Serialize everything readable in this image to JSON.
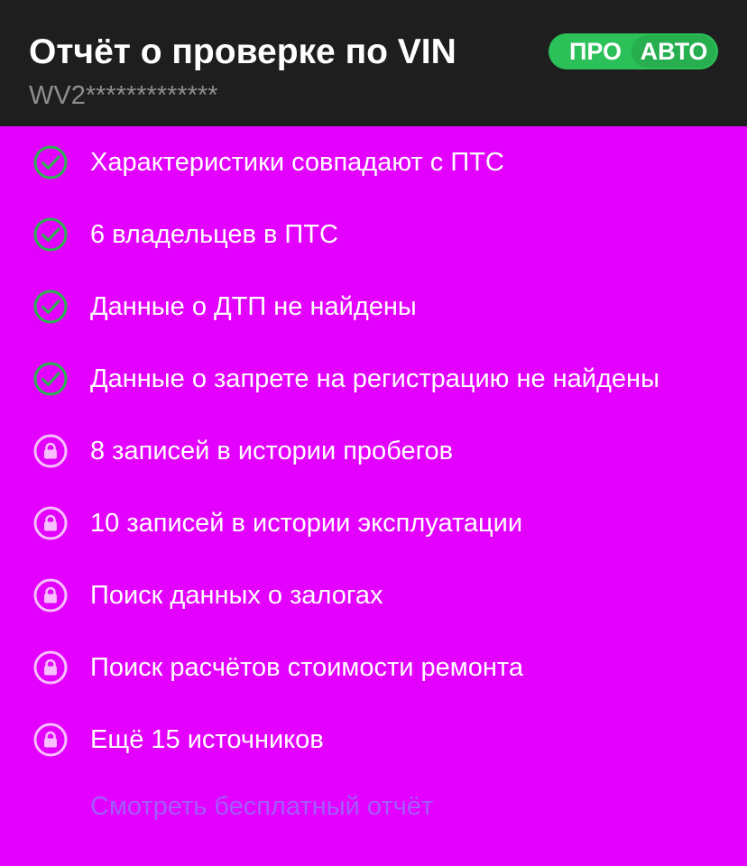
{
  "header": {
    "title": "Отчёт о проверке по VIN",
    "vin": "WV2*************",
    "badge": {
      "left": "ПРО",
      "right": "АВТО"
    }
  },
  "colors": {
    "header_bg": "#1E1E1F",
    "body_bg": "#E400FF",
    "check_icon": "#2BB34E",
    "lock_icon": "#FFFFFF",
    "link": "#A35CFF",
    "badge_green": "#2BC058"
  },
  "items": [
    {
      "icon": "check-circle-icon",
      "text": "Характеристики совпадают с ПТС"
    },
    {
      "icon": "check-circle-icon",
      "text": "6 владельцев в ПТС"
    },
    {
      "icon": "check-circle-icon",
      "text": "Данные о ДТП не найдены"
    },
    {
      "icon": "check-circle-icon",
      "text": "Данные о запрете на регистрацию не найдены"
    },
    {
      "icon": "lock-icon",
      "text": "8 записей в истории пробегов"
    },
    {
      "icon": "lock-icon",
      "text": "10 записей в истории эксплуатации"
    },
    {
      "icon": "lock-icon",
      "text": "Поиск данных о залогах"
    },
    {
      "icon": "lock-icon",
      "text": "Поиск расчётов стоимости ремонта"
    },
    {
      "icon": "lock-icon",
      "text": "Ещё 15 источников"
    }
  ],
  "link": {
    "label": "Смотреть бесплатный отчёт"
  }
}
